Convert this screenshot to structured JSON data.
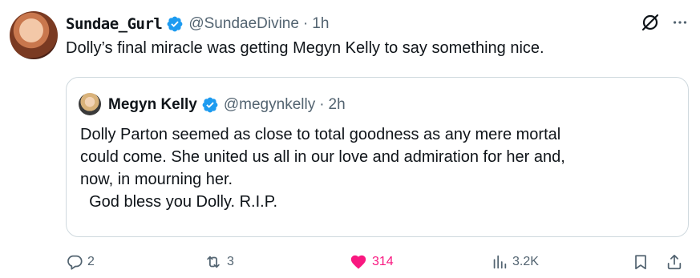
{
  "tweet": {
    "display_name": "Sundae_Gurl",
    "handle": "@SundaeDivine",
    "separator": "·",
    "time": "1h",
    "text": "Dolly’s final miracle was getting Megyn Kelly to say something nice."
  },
  "quoted": {
    "display_name": "Megyn Kelly",
    "handle": "@megynkelly",
    "separator": "·",
    "time": "2h",
    "text": "Dolly Parton seemed as close to total goodness as any mere mortal\ncould come. She united us all in our love and admiration for her and,\nnow, in mourning her.\n  God bless you Dolly. R.I.P."
  },
  "actions": {
    "replies": "2",
    "reposts": "3",
    "likes": "314",
    "views": "3.2K"
  },
  "colors": {
    "verified": "#1d9bf0",
    "like": "#f91880",
    "muted": "#536471"
  }
}
